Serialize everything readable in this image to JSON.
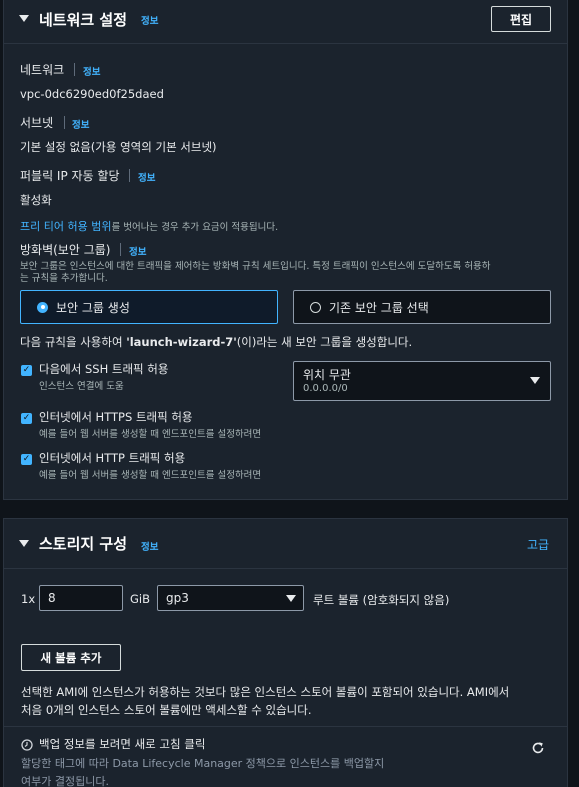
{
  "network": {
    "title": "네트워크 설정",
    "info": "정보",
    "edit_button": "편집",
    "network_label": "네트워크",
    "network_info": "정보",
    "vpc_id": "vpc-0dc6290ed0f25daed",
    "subnet_label": "서브넷",
    "subnet_info": "정보",
    "subnet_value": "기본 설정 없음(가용 영역의 기본 서브넷)",
    "public_ip_label": "퍼블릭 IP 자동 할당",
    "public_ip_info": "정보",
    "public_ip_value": "활성화",
    "free_tier_link": "프리 티어 허용 범위",
    "free_tier_note": "를 벗어나는 경우 추가 요금이 적용됩니다.",
    "firewall_label": "방화벽(보안 그룹)",
    "firewall_info": "정보",
    "firewall_desc_line1": "보안 그룹은 인스턴스에 대한 트래픽을 제어하는 방화벽 규칙 세트입니다. 특정 트래픽이 인스턴스에 도달하도록 허용하",
    "firewall_desc_line2": "는 규칙을 추가합니다.",
    "radio_create": "보안 그룹 생성",
    "radio_existing": "기존 보안 그룹 선택",
    "rules_prefix": "다음 규칙을 사용하여 ",
    "rules_name": "'launch-wizard-7'",
    "rules_suffix": "(이)라는 새 보안 그룹을 생성합니다.",
    "ssh_label": "다음에서 SSH 트래픽 허용",
    "ssh_sub": "인스턴스 연결에 도움",
    "ssh_source_value": "위치 무관",
    "ssh_source_cidr": "0.0.0.0/0",
    "https_label": "인터넷에서 HTTPS 트래픽 허용",
    "https_sub": "예를 들어 웹 서버를 생성할 때 엔드포인트를 설정하려면",
    "http_label": "인터넷에서 HTTP 트래픽 허용",
    "http_sub": "예를 들어 웹 서버를 생성할 때 엔드포인트를 설정하려면"
  },
  "storage": {
    "title": "스토리지 구성",
    "info": "정보",
    "advanced_link": "고급",
    "count_label": "1x",
    "size_value": "8",
    "size_unit": "GiB",
    "volume_type": "gp3",
    "volume_desc": "루트 볼륨  (암호화되지 않음)",
    "add_volume_button": "새 볼륨 추가",
    "notice_line1": "선택한 AMI에 인스턴스가 허용하는 것보다 많은 인스턴스 스토어 볼륨이 포함되어 있습니다. AMI에서",
    "notice_line2": "처음 0개의 인스턴스 스토어 볼륨에만 액세스할 수 있습니다.",
    "backup_title": "백업 정보를 보려면 새로 고침 클릭",
    "backup_line1": "할당한 태그에 따라 Data Lifecycle Manager 정책으로 인스턴스를 백업할지",
    "backup_line2": "여부가 결정됩니다."
  }
}
